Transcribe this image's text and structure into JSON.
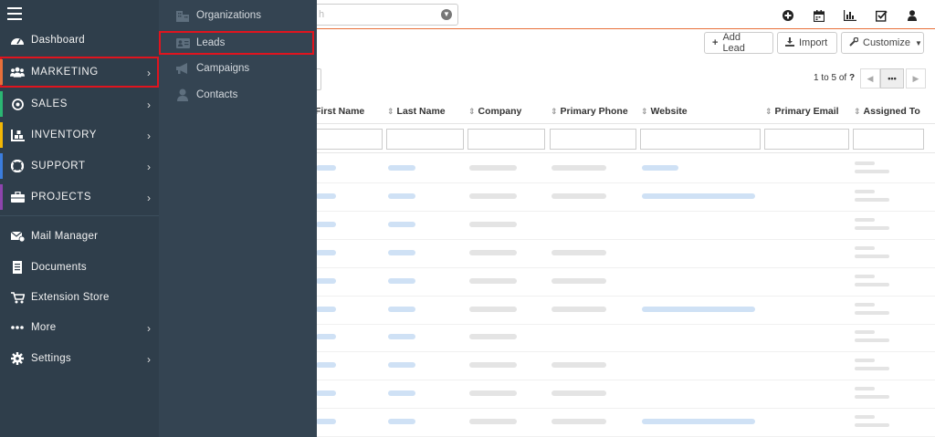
{
  "topbar": {
    "search_placeholder": "h",
    "icons": [
      "plus-circle-icon",
      "calendar-icon",
      "bar-chart-icon",
      "checkbox-icon",
      "user-icon"
    ]
  },
  "actions": {
    "add_lead": "Add Lead",
    "import": "Import",
    "customize": "Customize"
  },
  "pager": {
    "range": "1 to 5",
    "of_label": "of",
    "total": "?",
    "more": "•••"
  },
  "table": {
    "columns": [
      "First Name",
      "Last Name",
      "Company",
      "Primary Phone",
      "Website",
      "Primary Email",
      "Assigned To"
    ]
  },
  "sidebar": {
    "items": [
      {
        "label": "Dashboard",
        "icon": "dashboard-icon"
      },
      {
        "label": "MARKETING",
        "icon": "users-group-icon",
        "stripe": "#e8703a"
      },
      {
        "label": "SALES",
        "icon": "target-icon",
        "stripe": "#2bb673"
      },
      {
        "label": "INVENTORY",
        "icon": "inventory-icon",
        "stripe": "#f2b705"
      },
      {
        "label": "SUPPORT",
        "icon": "lifebuoy-icon",
        "stripe": "#3b7ddd"
      },
      {
        "label": "PROJECTS",
        "icon": "briefcase-icon",
        "stripe": "#8e44ad"
      },
      {
        "label": "Mail Manager",
        "icon": "mail-icon"
      },
      {
        "label": "Documents",
        "icon": "document-icon"
      },
      {
        "label": "Extension Store",
        "icon": "cart-icon"
      },
      {
        "label": "More",
        "icon": "ellipsis-icon"
      },
      {
        "label": "Settings",
        "icon": "gear-icon"
      }
    ],
    "chevron": "›"
  },
  "submenu": {
    "items": [
      {
        "label": "Organizations",
        "icon": "building-icon"
      },
      {
        "label": "Leads",
        "icon": "id-card-icon"
      },
      {
        "label": "Campaigns",
        "icon": "megaphone-icon"
      },
      {
        "label": "Contacts",
        "icon": "person-icon"
      }
    ]
  },
  "colors": {
    "sidebar_bg": "#2f3e4b",
    "submenu_bg": "#344452",
    "accent": "#e8703a",
    "highlight": "#e0141e"
  }
}
